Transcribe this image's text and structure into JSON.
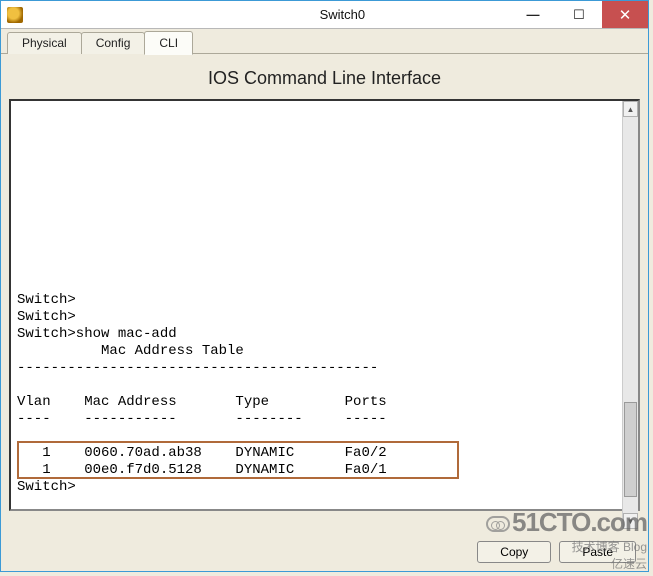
{
  "window": {
    "title": "Switch0"
  },
  "tabs": [
    {
      "label": "Physical"
    },
    {
      "label": "Config"
    },
    {
      "label": "CLI"
    }
  ],
  "active_tab": 2,
  "panel": {
    "title": "IOS Command Line Interface"
  },
  "cli": {
    "prompt": "Switch>",
    "command": "show mac-add",
    "table_title": "Mac Address Table",
    "dash_title": "-------------------------------------------",
    "headers": {
      "vlan": "Vlan",
      "mac": "Mac Address",
      "type": "Type",
      "ports": "Ports"
    },
    "dash_cols": {
      "vlan": "----",
      "mac": "-----------",
      "type": "--------",
      "ports": "-----"
    },
    "rows": [
      {
        "vlan": "1",
        "mac": "0060.70ad.ab38",
        "type": "DYNAMIC",
        "ports": "Fa0/2"
      },
      {
        "vlan": "1",
        "mac": "00e0.f7d0.5128",
        "type": "DYNAMIC",
        "ports": "Fa0/1"
      }
    ],
    "final_prompt": "Switch>"
  },
  "buttons": {
    "copy": "Copy",
    "paste": "Paste"
  },
  "title_buttons": {
    "minimize": "—",
    "maximize": "☐",
    "close": "✕"
  },
  "watermark": {
    "line1": "51CTO.com",
    "line2": "技术博客  Blog",
    "line3": "亿速云"
  }
}
